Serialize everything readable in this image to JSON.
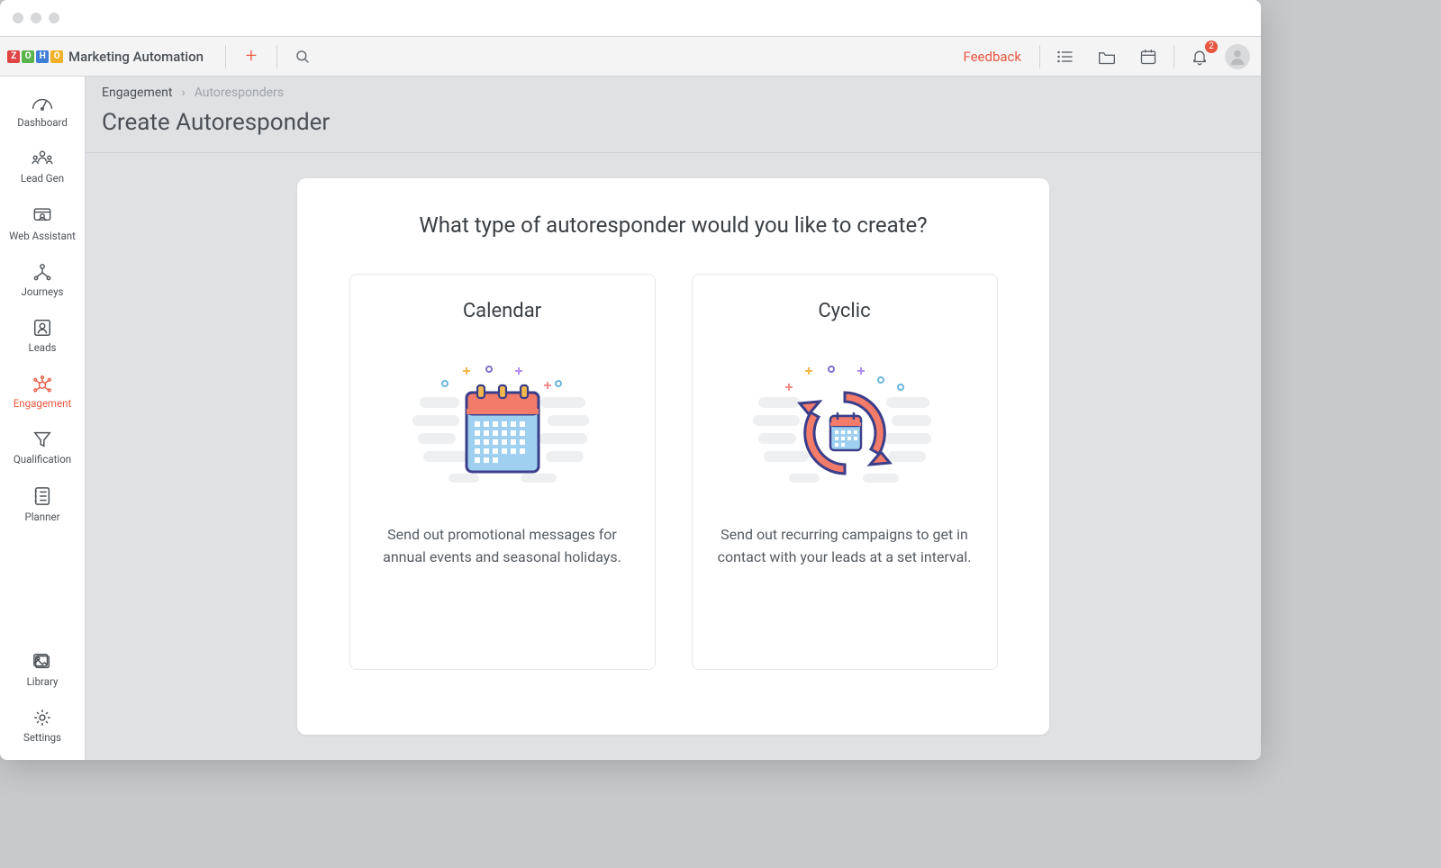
{
  "brand": {
    "logo_letters": [
      "Z",
      "O",
      "H",
      "O"
    ],
    "logo_colors": [
      "#e04646",
      "#5ab34b",
      "#3f7ed6",
      "#f1b028"
    ],
    "product_name": "Marketing Automation"
  },
  "topbar": {
    "feedback_label": "Feedback",
    "notification_count": "2"
  },
  "nav": {
    "top_items": [
      {
        "key": "dashboard",
        "label": "Dashboard"
      },
      {
        "key": "lead-gen",
        "label": "Lead Gen"
      },
      {
        "key": "web-assistant",
        "label": "Web Assistant"
      },
      {
        "key": "journeys",
        "label": "Journeys"
      },
      {
        "key": "leads",
        "label": "Leads"
      },
      {
        "key": "engagement",
        "label": "Engagement"
      },
      {
        "key": "qualification",
        "label": "Qualification"
      },
      {
        "key": "planner",
        "label": "Planner"
      }
    ],
    "bottom_items": [
      {
        "key": "library",
        "label": "Library"
      },
      {
        "key": "settings",
        "label": "Settings"
      }
    ],
    "active_key": "engagement"
  },
  "breadcrumb": {
    "parent": "Engagement",
    "current": "Autoresponders"
  },
  "page": {
    "title": "Create Autoresponder",
    "panel_heading": "What type of autoresponder would you like to create?"
  },
  "options": [
    {
      "key": "calendar",
      "title": "Calendar",
      "description": "Send out promotional messages for annual events and seasonal holidays."
    },
    {
      "key": "cyclic",
      "title": "Cyclic",
      "description": "Send out recurring campaigns to get in contact with your leads at a set interval."
    }
  ]
}
